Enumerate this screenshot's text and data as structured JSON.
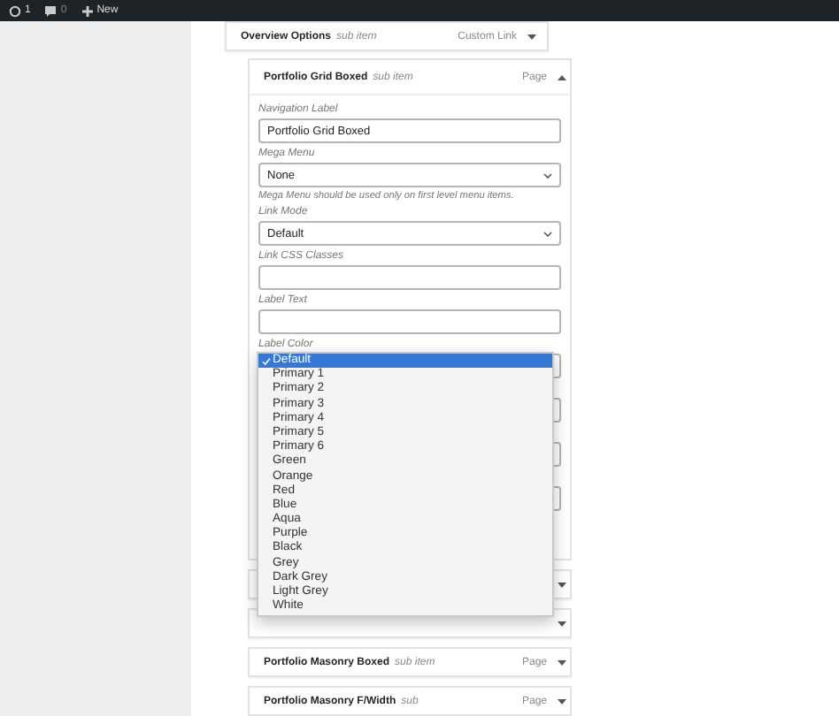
{
  "admin_bar": {
    "updates": "1",
    "comments": "0",
    "new": "New"
  },
  "menu_items_top": [
    {
      "title": "Overview Options",
      "subtitle": "sub item",
      "type": "Custom Link",
      "expanded": false
    }
  ],
  "open_item": {
    "title": "Portfolio Grid Boxed",
    "subtitle": "sub item",
    "type": "Page",
    "expanded": true,
    "fields": [
      {
        "kind": "text",
        "label": "Navigation Label",
        "value": "Portfolio Grid Boxed"
      },
      {
        "kind": "select",
        "label": "Mega Menu",
        "value": "None",
        "help": "Mega Menu should be used only on first level menu items."
      },
      {
        "kind": "select",
        "label": "Link Mode",
        "value": "Default"
      },
      {
        "kind": "text",
        "label": "Link CSS Classes"
      },
      {
        "kind": "text",
        "label": "Label Text"
      },
      {
        "kind": "select",
        "label": "Label Color",
        "open": true
      },
      {
        "kind": "select"
      },
      {
        "kind": "select"
      },
      {
        "kind": "text"
      }
    ]
  },
  "dropdown_options": [
    {
      "label": "Default",
      "selected": true
    },
    {
      "label": "Primary 1",
      "selected": false
    },
    {
      "label": "Primary 2",
      "selected": false
    },
    {
      "label": "Primary 3",
      "selected": false
    },
    {
      "label": "Primary 4",
      "selected": false
    },
    {
      "label": "Primary 5",
      "selected": false
    },
    {
      "label": "Primary 6",
      "selected": false
    },
    {
      "label": "Green",
      "selected": false
    },
    {
      "label": "Orange",
      "selected": false
    },
    {
      "label": "Red",
      "selected": false
    },
    {
      "label": "Blue",
      "selected": false
    },
    {
      "label": "Aqua",
      "selected": false
    },
    {
      "label": "Purple",
      "selected": false
    },
    {
      "label": "Black",
      "selected": false
    },
    {
      "label": "Grey",
      "selected": false
    },
    {
      "label": "Dark Grey",
      "selected": false
    },
    {
      "label": "Light Grey",
      "selected": false
    },
    {
      "label": "White",
      "selected": false
    }
  ],
  "menu_items_bottom": [
    {
      "expanded": false
    },
    {
      "expanded": false
    },
    {
      "title": "Portfolio Masonry Boxed",
      "subtitle": "sub item",
      "type": "Page",
      "expanded": false
    },
    {
      "title": "Portfolio Masonry F/Width",
      "subtitle": "sub",
      "type": "Page",
      "expanded": false
    }
  ]
}
